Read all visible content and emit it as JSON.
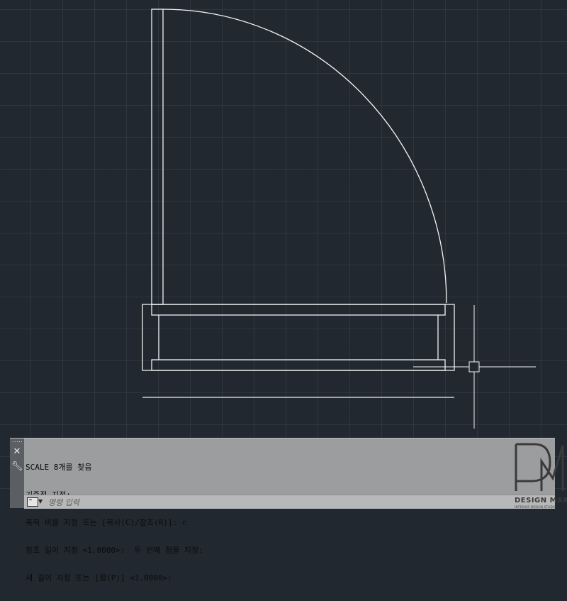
{
  "command_line": {
    "history": [
      "SCALE 8개를 찾음",
      "기준점 지정:",
      "축척 비율 지정 또는 [복사(C)/참조(R)]: r",
      "참조 길이 지정 <1.0000>:  두 번째 점을 지정:",
      "새 길이 지정 또는 [점(P)] <1.0000>:"
    ],
    "input_placeholder": "명령 입력",
    "close_icon": "close-icon",
    "customize_icon": "wrench-icon",
    "prompt_icon": "command-prompt-icon",
    "dropdown_icon": "chevron-down-icon"
  },
  "watermark": {
    "brand": "DESIGN MAX",
    "tagline": "INTERIOR DESIGN STUDIO"
  },
  "colors": {
    "canvas_background": "#212830",
    "grid_line": "#3a4350",
    "drawing_stroke": "#f2f2f2",
    "command_panel": "#9c9d9e",
    "command_grip": "#5b5f64"
  }
}
